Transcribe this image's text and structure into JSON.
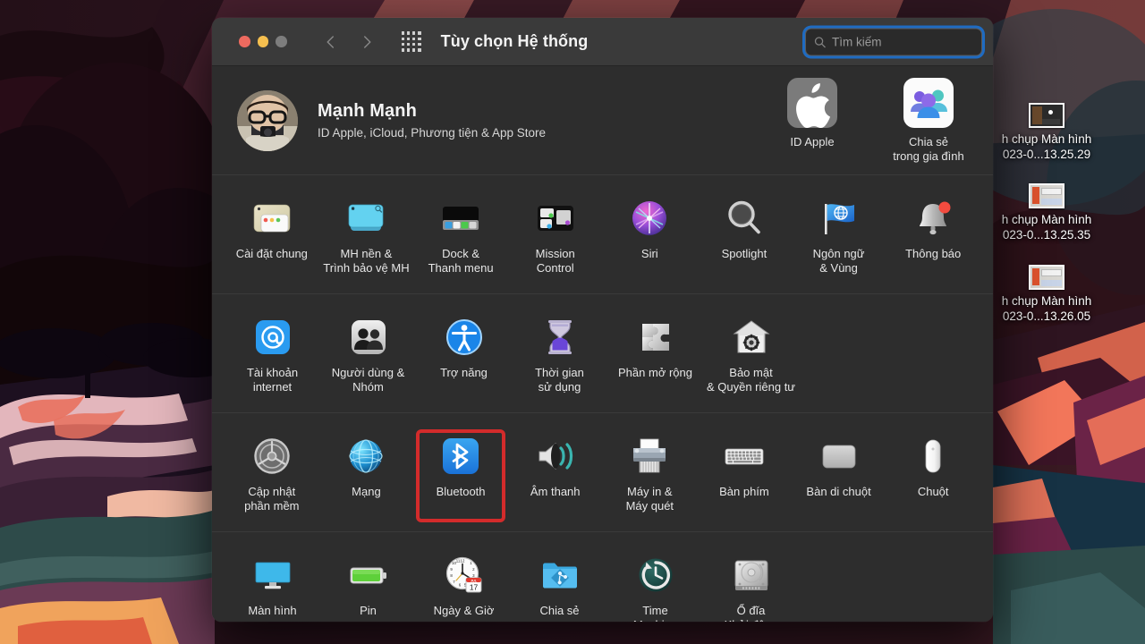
{
  "window": {
    "title": "Tùy chọn Hệ thống",
    "traffic_lights": [
      "close-red",
      "minimize-yellow",
      "zoom-gray"
    ],
    "nav_back": "back-chevron",
    "nav_forward": "forward-chevron",
    "grid_button": "show-all-grid-icon",
    "colors": {
      "titlebar_bg": "#3a3a3a",
      "body_bg": "#2d2d2d",
      "focus_ring": "#1e6ec8",
      "highlight_red": "#d32b2b",
      "close": "#ed6a5f",
      "minimize": "#f5bf4f",
      "zoom": "#7d7d7d"
    }
  },
  "search": {
    "placeholder": "Tìm kiếm",
    "value": "",
    "icon": "search-icon",
    "focused": true
  },
  "account": {
    "name": "Mạnh Mạnh",
    "subtitle": "ID Apple, iCloud, Phương tiện & App Store",
    "avatar_alt": "user-avatar-photo",
    "shortcuts": [
      {
        "label": "ID Apple",
        "icon": "apple-logo-icon"
      },
      {
        "label": "Chia sẻ\ntrong gia đình",
        "label_line1": "Chia sẻ",
        "label_line2": "trong gia đình",
        "icon": "family-sharing-icon"
      }
    ]
  },
  "sections": [
    {
      "name": "personal",
      "items": [
        {
          "label_line1": "Cài đặt chung",
          "label_line2": "",
          "icon": "general-settings-icon"
        },
        {
          "label_line1": "MH nền &",
          "label_line2": "Trình bảo vệ MH",
          "icon": "desktop-screensaver-icon"
        },
        {
          "label_line1": "Dock &",
          "label_line2": "Thanh menu",
          "icon": "dock-menubar-icon"
        },
        {
          "label_line1": "Mission",
          "label_line2": "Control",
          "icon": "mission-control-icon"
        },
        {
          "label_line1": "Siri",
          "label_line2": "",
          "icon": "siri-icon"
        },
        {
          "label_line1": "Spotlight",
          "label_line2": "",
          "icon": "spotlight-icon"
        },
        {
          "label_line1": "Ngôn ngữ",
          "label_line2": "& Vùng",
          "icon": "language-region-icon"
        },
        {
          "label_line1": "Thông báo",
          "label_line2": "",
          "icon": "notifications-icon"
        }
      ]
    },
    {
      "name": "accounts",
      "items": [
        {
          "label_line1": "Tài khoản",
          "label_line2": "internet",
          "icon": "internet-accounts-icon"
        },
        {
          "label_line1": "Người dùng &",
          "label_line2": "Nhóm",
          "icon": "users-groups-icon"
        },
        {
          "label_line1": "Trợ năng",
          "label_line2": "",
          "icon": "accessibility-icon"
        },
        {
          "label_line1": "Thời gian",
          "label_line2": "sử dụng",
          "icon": "screen-time-icon"
        },
        {
          "label_line1": "Phần mở rộng",
          "label_line2": "",
          "icon": "extensions-icon"
        },
        {
          "label_line1": "Bảo mật",
          "label_line2": "& Quyền riêng tư",
          "icon": "security-privacy-icon"
        }
      ]
    },
    {
      "name": "hardware",
      "items": [
        {
          "label_line1": "Cập nhật",
          "label_line2": "phần mềm",
          "icon": "software-update-icon"
        },
        {
          "label_line1": "Mạng",
          "label_line2": "",
          "icon": "network-icon"
        },
        {
          "label_line1": "Bluetooth",
          "label_line2": "",
          "icon": "bluetooth-icon",
          "selected": true
        },
        {
          "label_line1": "Âm thanh",
          "label_line2": "",
          "icon": "sound-icon"
        },
        {
          "label_line1": "Máy in &",
          "label_line2": "Máy quét",
          "icon": "printers-scanners-icon"
        },
        {
          "label_line1": "Bàn phím",
          "label_line2": "",
          "icon": "keyboard-icon"
        },
        {
          "label_line1": "Bàn di chuột",
          "label_line2": "",
          "icon": "trackpad-icon"
        },
        {
          "label_line1": "Chuột",
          "label_line2": "",
          "icon": "mouse-icon"
        }
      ]
    },
    {
      "name": "system",
      "items": [
        {
          "label_line1": "Màn hình",
          "label_line2": "",
          "icon": "displays-icon"
        },
        {
          "label_line1": "Pin",
          "label_line2": "",
          "icon": "battery-icon"
        },
        {
          "label_line1": "Ngày & Giờ",
          "label_line2": "",
          "icon": "date-time-icon"
        },
        {
          "label_line1": "Chia sẻ",
          "label_line2": "",
          "icon": "sharing-icon"
        },
        {
          "label_line1": "Time",
          "label_line2": "Machine",
          "icon": "time-machine-icon"
        },
        {
          "label_line1": "Ổ đĩa",
          "label_line2": "Khởi động",
          "icon": "startup-disk-icon"
        }
      ]
    }
  ],
  "desktop": {
    "files": [
      {
        "name_line1": "h chụp Màn hình",
        "name_line2": "023-0...13.25.29",
        "icon": "screenshot-thumbnail",
        "style": "dark"
      },
      {
        "name_line1": "h chụp Màn hình",
        "name_line2": "023-0...13.25.35",
        "icon": "screenshot-thumbnail",
        "style": "light"
      },
      {
        "name_line1": "h chụp Màn hình",
        "name_line2": "023-0...13.26.05",
        "icon": "screenshot-thumbnail",
        "style": "light"
      }
    ],
    "wallpaper_name": "tropical-sunset-wallpaper"
  },
  "date_icon": {
    "month": "JUL",
    "day": "17"
  }
}
